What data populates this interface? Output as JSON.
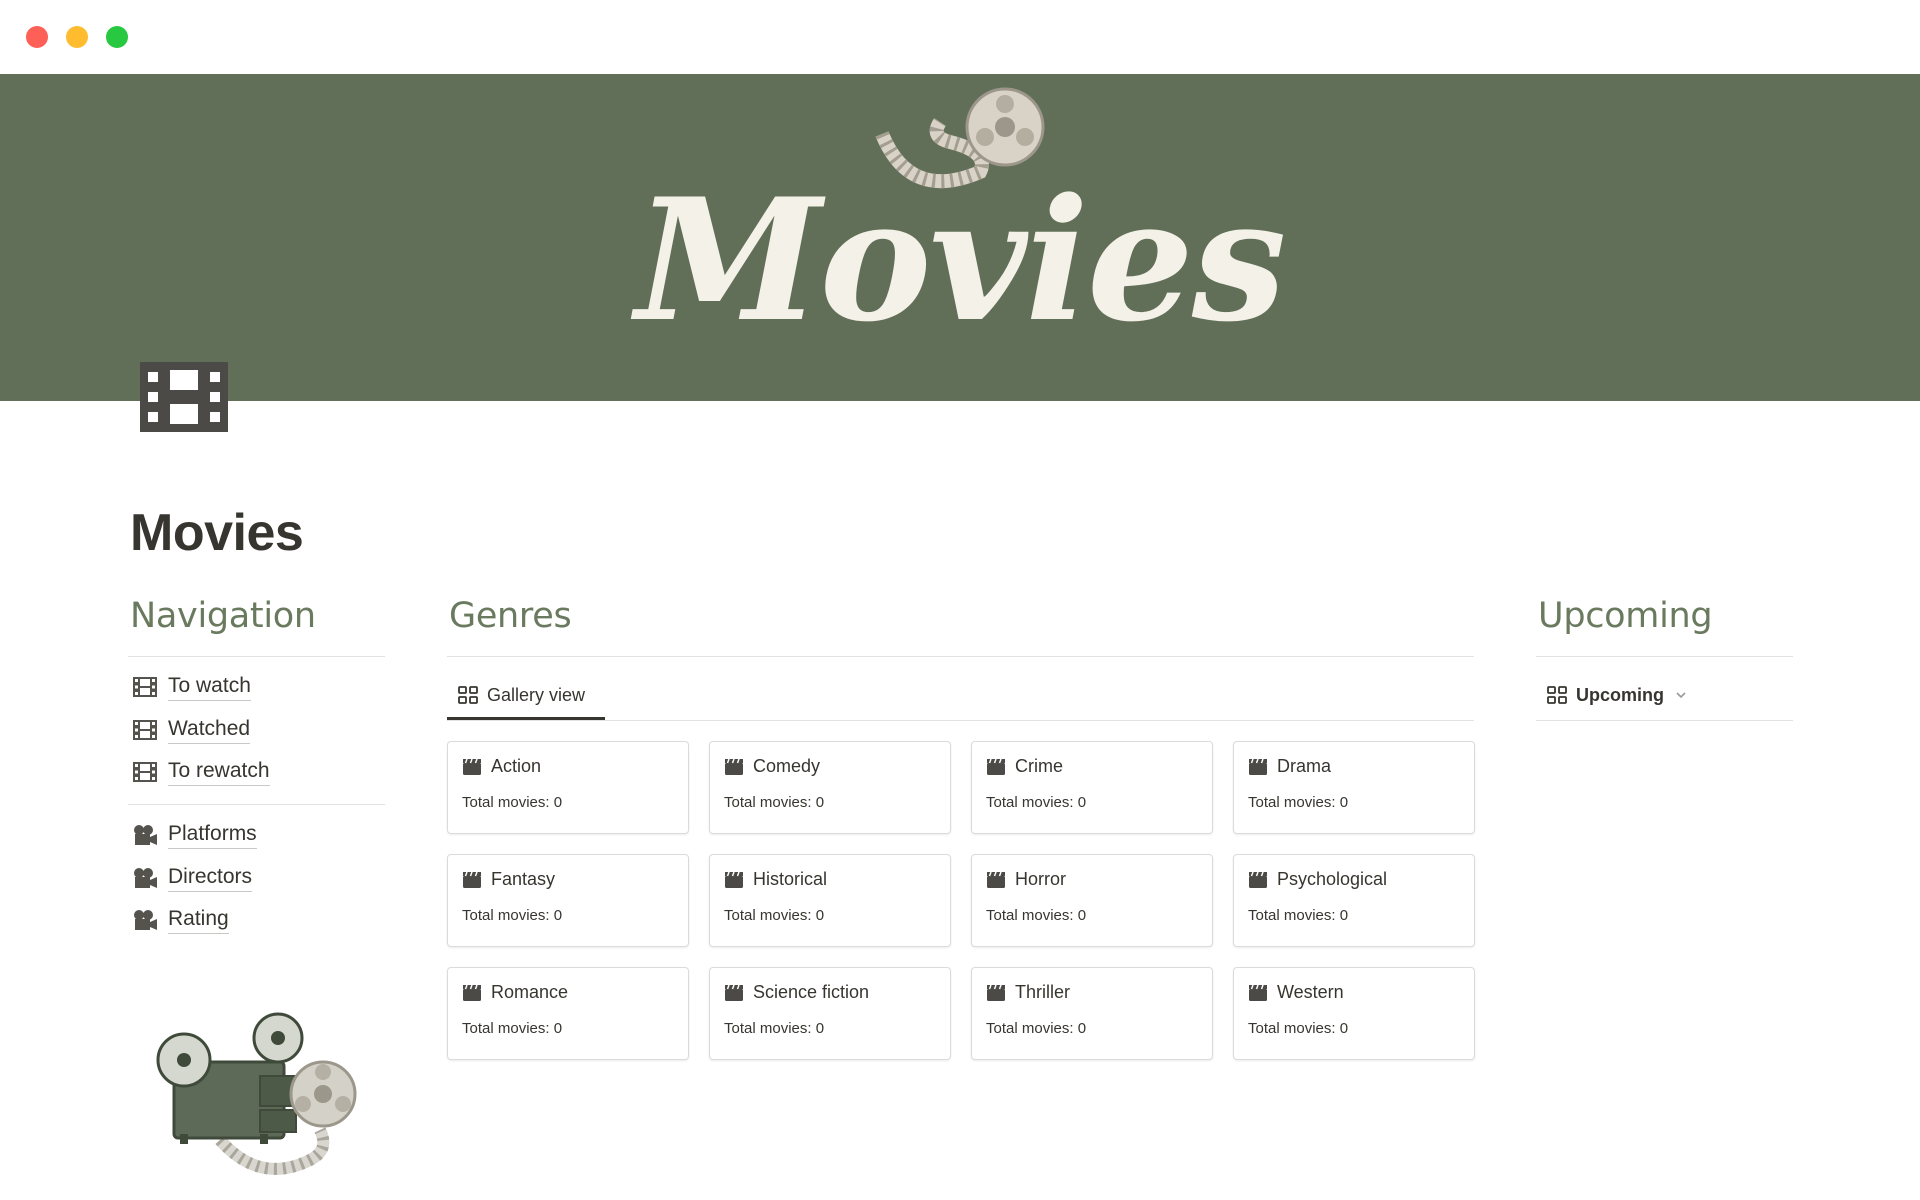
{
  "window": {
    "controls": [
      "close",
      "minimize",
      "maximize"
    ]
  },
  "cover": {
    "title": "Movies",
    "background": "#626f58",
    "text_color": "#f4f1e8"
  },
  "page": {
    "title": "Movies",
    "icon": "film-strip-icon"
  },
  "navigation": {
    "heading": "Navigation",
    "groups": [
      {
        "icon": "film-strip-icon",
        "items": [
          {
            "label": "To watch"
          },
          {
            "label": "Watched"
          },
          {
            "label": "To rewatch"
          }
        ]
      },
      {
        "icon": "movie-camera-icon",
        "items": [
          {
            "label": "Platforms"
          },
          {
            "label": "Directors"
          },
          {
            "label": "Rating"
          }
        ]
      }
    ]
  },
  "genres": {
    "heading": "Genres",
    "view_tab": {
      "label": "Gallery view",
      "icon": "gallery-grid-icon"
    },
    "cards": [
      {
        "name": "Action",
        "count_text": "Total movies: 0"
      },
      {
        "name": "Comedy",
        "count_text": "Total movies: 0"
      },
      {
        "name": "Crime",
        "count_text": "Total movies: 0"
      },
      {
        "name": "Drama",
        "count_text": "Total movies: 0"
      },
      {
        "name": "Fantasy",
        "count_text": "Total movies: 0"
      },
      {
        "name": "Historical",
        "count_text": "Total movies: 0"
      },
      {
        "name": "Horror",
        "count_text": "Total movies: 0"
      },
      {
        "name": "Psychological",
        "count_text": "Total movies: 0"
      },
      {
        "name": "Romance",
        "count_text": "Total movies: 0"
      },
      {
        "name": "Science fiction",
        "count_text": "Total movies: 0"
      },
      {
        "name": "Thriller",
        "count_text": "Total movies: 0"
      },
      {
        "name": "Western",
        "count_text": "Total movies: 0"
      }
    ],
    "card_icon": "clapperboard-icon"
  },
  "upcoming": {
    "heading": "Upcoming",
    "view_tab": {
      "label": "Upcoming",
      "icon": "gallery-grid-icon",
      "dropdown_icon": "chevron-down-icon"
    }
  },
  "colors": {
    "heading_green": "#6a7a5e",
    "text": "#37352f",
    "divider": "#e3e2e0"
  }
}
